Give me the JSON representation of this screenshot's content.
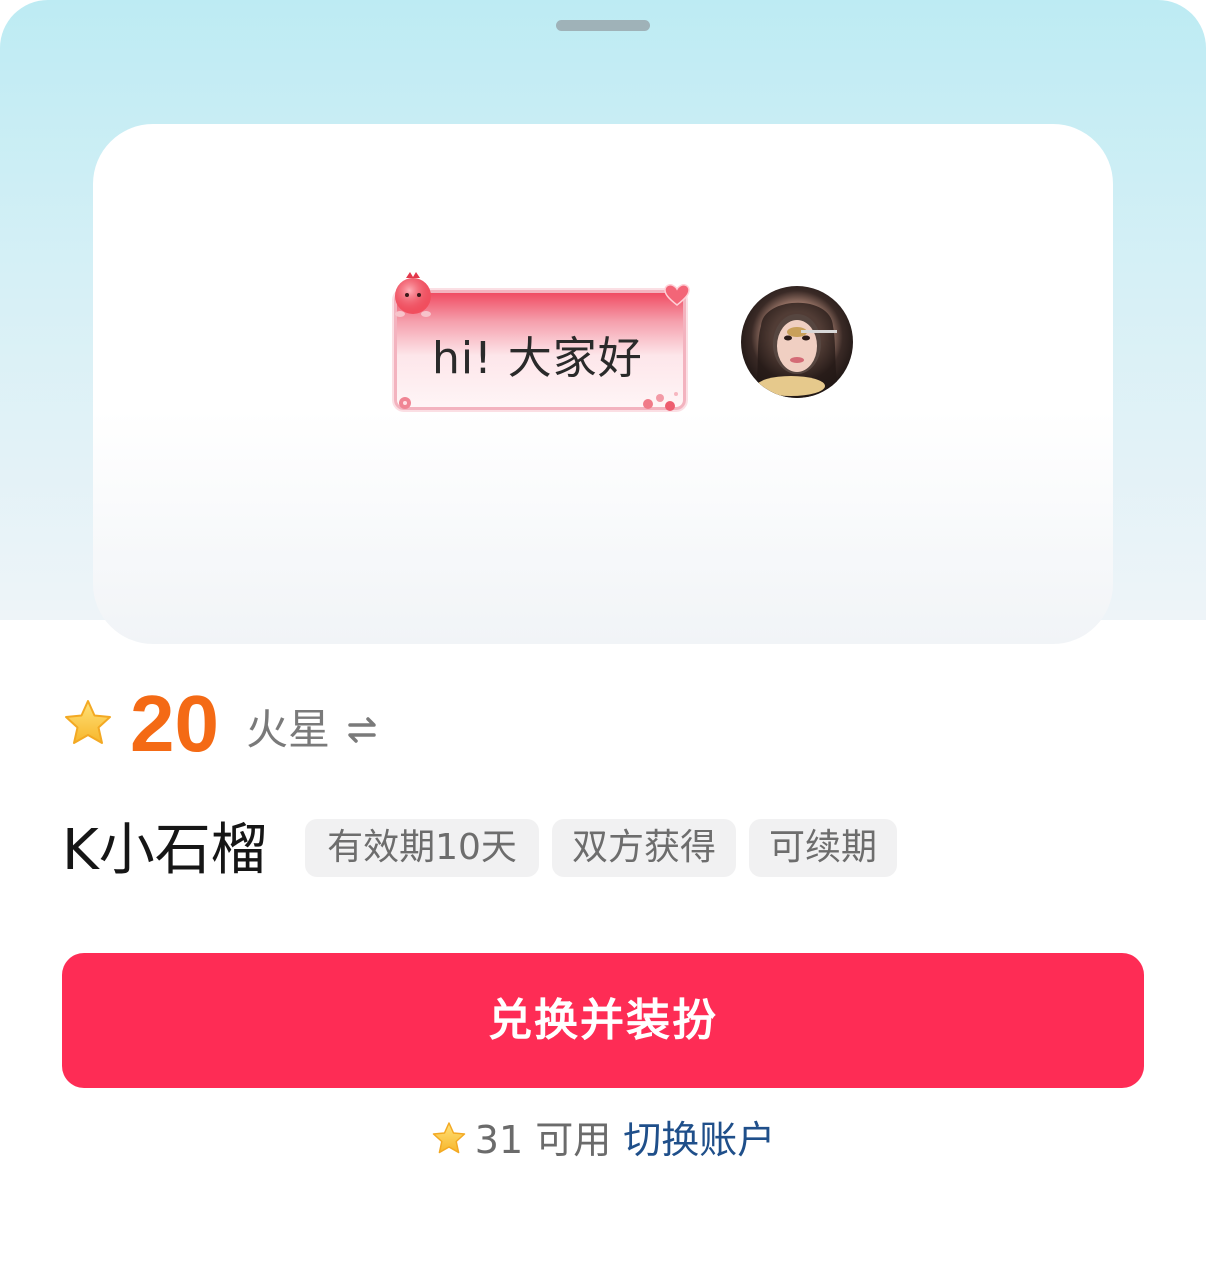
{
  "preview": {
    "bubble_text": "hi! 大家好"
  },
  "price": {
    "value": "20",
    "unit": "火星",
    "currency_icon": "star-icon",
    "switch_icon": "swap-arrows-icon"
  },
  "item": {
    "name": "K小石榴",
    "tags": [
      "有效期10天",
      "双方获得",
      "可续期"
    ]
  },
  "actions": {
    "primary_label": "兑换并装扮"
  },
  "balance": {
    "text": "31 可用",
    "switch_account_label": "切换账户"
  },
  "colors": {
    "price": "#f46a15",
    "cta": "#fe2c55",
    "link": "#1f4f8a"
  }
}
